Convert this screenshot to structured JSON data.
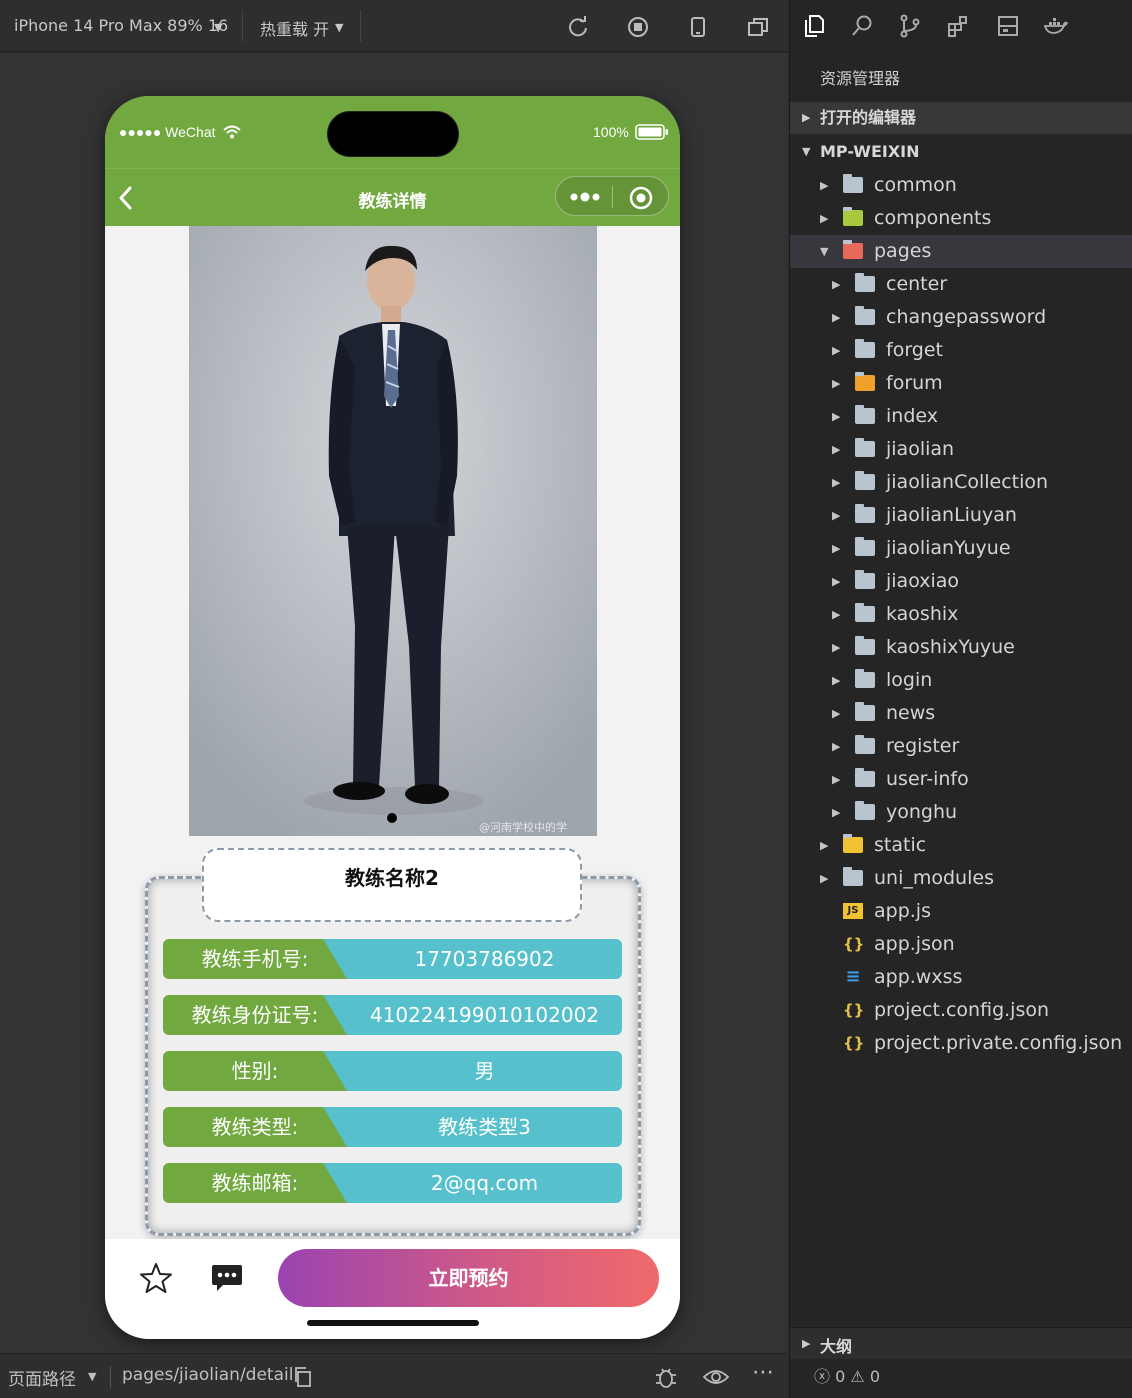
{
  "toolbar": {
    "device": "iPhone 14 Pro Max 89% 16",
    "hot_reload": "热重载 开"
  },
  "phone": {
    "status": {
      "carrier": "●●●●● WeChat",
      "battery": "100%"
    },
    "nav": {
      "title": "教练详情"
    },
    "coach": {
      "name": "教练名称2",
      "fields": [
        {
          "label": "教练手机号:",
          "value": "17703786902"
        },
        {
          "label": "教练身份证号:",
          "value": "410224199010102002"
        },
        {
          "label": "性别:",
          "value": "男"
        },
        {
          "label": "教练类型:",
          "value": "教练类型3"
        },
        {
          "label": "教练邮箱:",
          "value": "2@qq.com"
        }
      ]
    },
    "watermark": "@河南学校中的学",
    "book_button": "立即预约"
  },
  "bottom_status": {
    "path_label": "页面路径",
    "path": "pages/jiaolian/detail"
  },
  "explorer": {
    "title": "资源管理器",
    "open_editors": "打开的编辑器",
    "project": "MP-WEIXIN",
    "tree": [
      {
        "label": "common",
        "depth": 1,
        "kind": "folder",
        "arrow": "▶"
      },
      {
        "label": "components",
        "depth": 1,
        "kind": "folder-components",
        "arrow": "▶"
      },
      {
        "label": "pages",
        "depth": 1,
        "kind": "folder-pages",
        "arrow": "▼"
      },
      {
        "label": "center",
        "depth": 2,
        "kind": "folder",
        "arrow": "▶"
      },
      {
        "label": "changepassword",
        "depth": 2,
        "kind": "folder",
        "arrow": "▶"
      },
      {
        "label": "forget",
        "depth": 2,
        "kind": "folder",
        "arrow": "▶"
      },
      {
        "label": "forum",
        "depth": 2,
        "kind": "folder-forum",
        "arrow": "▶"
      },
      {
        "label": "index",
        "depth": 2,
        "kind": "folder",
        "arrow": "▶"
      },
      {
        "label": "jiaolian",
        "depth": 2,
        "kind": "folder",
        "arrow": "▶"
      },
      {
        "label": "jiaolianCollection",
        "depth": 2,
        "kind": "folder",
        "arrow": "▶"
      },
      {
        "label": "jiaolianLiuyan",
        "depth": 2,
        "kind": "folder",
        "arrow": "▶"
      },
      {
        "label": "jiaolianYuyue",
        "depth": 2,
        "kind": "folder",
        "arrow": "▶"
      },
      {
        "label": "jiaoxiao",
        "depth": 2,
        "kind": "folder",
        "arrow": "▶"
      },
      {
        "label": "kaoshix",
        "depth": 2,
        "kind": "folder",
        "arrow": "▶"
      },
      {
        "label": "kaoshixYuyue",
        "depth": 2,
        "kind": "folder",
        "arrow": "▶"
      },
      {
        "label": "login",
        "depth": 2,
        "kind": "folder",
        "arrow": "▶"
      },
      {
        "label": "news",
        "depth": 2,
        "kind": "folder",
        "arrow": "▶"
      },
      {
        "label": "register",
        "depth": 2,
        "kind": "folder",
        "arrow": "▶"
      },
      {
        "label": "user-info",
        "depth": 2,
        "kind": "folder",
        "arrow": "▶"
      },
      {
        "label": "yonghu",
        "depth": 2,
        "kind": "folder",
        "arrow": "▶"
      },
      {
        "label": "static",
        "depth": 1,
        "kind": "folder-static",
        "arrow": "▶"
      },
      {
        "label": "uni_modules",
        "depth": 1,
        "kind": "folder",
        "arrow": "▶"
      },
      {
        "label": "app.js",
        "depth": 1,
        "kind": "js",
        "arrow": ""
      },
      {
        "label": "app.json",
        "depth": 1,
        "kind": "json",
        "arrow": ""
      },
      {
        "label": "app.wxss",
        "depth": 1,
        "kind": "css",
        "arrow": ""
      },
      {
        "label": "project.config.json",
        "depth": 1,
        "kind": "json",
        "arrow": ""
      },
      {
        "label": "project.private.config.json",
        "depth": 1,
        "kind": "json",
        "arrow": ""
      }
    ],
    "outline": "大纲",
    "errors": "0",
    "warnings": "0"
  },
  "colors": {
    "nav_green": "#72a840",
    "value_teal": "#56c0cc",
    "button_gradient_start": "#9a44b0",
    "button_gradient_end": "#f06a6a"
  }
}
